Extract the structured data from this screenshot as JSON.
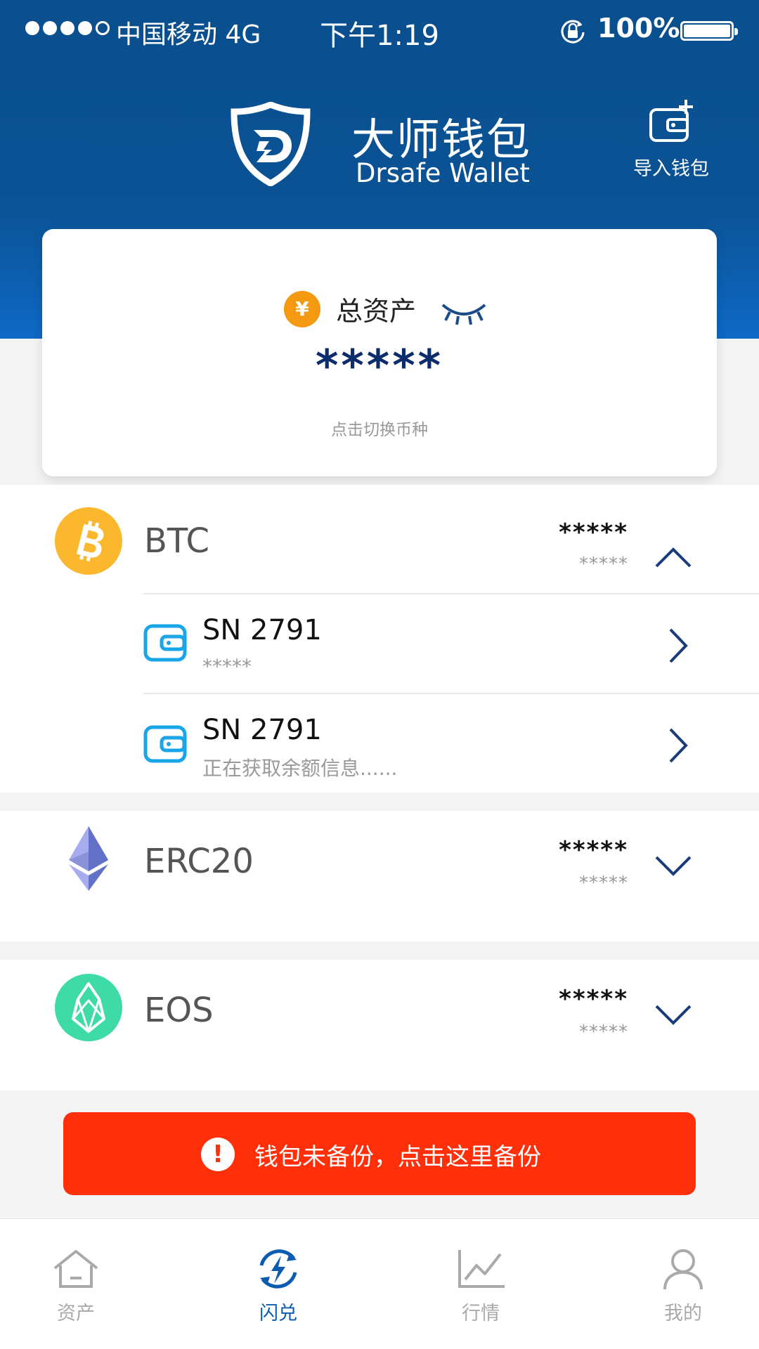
{
  "status_bar": {
    "carrier": "中国移动 4G",
    "time": "下午1:19",
    "battery": "100%"
  },
  "header": {
    "title": "大师钱包",
    "subtitle": "Drsafe Wallet",
    "import_label": "导入钱包"
  },
  "summary": {
    "currency_symbol": "¥",
    "label": "总资产",
    "value": "*****",
    "hint": "点击切换币种"
  },
  "coins": [
    {
      "name": "BTC",
      "amount": "*****",
      "value": "*****",
      "wallets": [
        {
          "name": "SN 2791",
          "balance": "*****"
        },
        {
          "name": "SN 2791",
          "balance": "正在获取余额信息......"
        }
      ]
    },
    {
      "name": "ERC20",
      "amount": "*****",
      "value": "*****"
    },
    {
      "name": "EOS",
      "amount": "*****",
      "value": "*****"
    }
  ],
  "warning": {
    "icon": "!",
    "text": "钱包未备份，点击这里备份"
  },
  "tabs": [
    {
      "label": "资产",
      "icon": "home-icon"
    },
    {
      "label": "闪兑",
      "icon": "flash-exchange-icon"
    },
    {
      "label": "行情",
      "icon": "chart-icon"
    },
    {
      "label": "我的",
      "icon": "user-icon"
    }
  ],
  "colors": {
    "primary": "#0b5396",
    "accent": "#0e69c6",
    "warning": "#ff2f0a",
    "btc": "#fbb72d",
    "eos": "#3fdba7",
    "active_tab": "#0b5bb0"
  }
}
